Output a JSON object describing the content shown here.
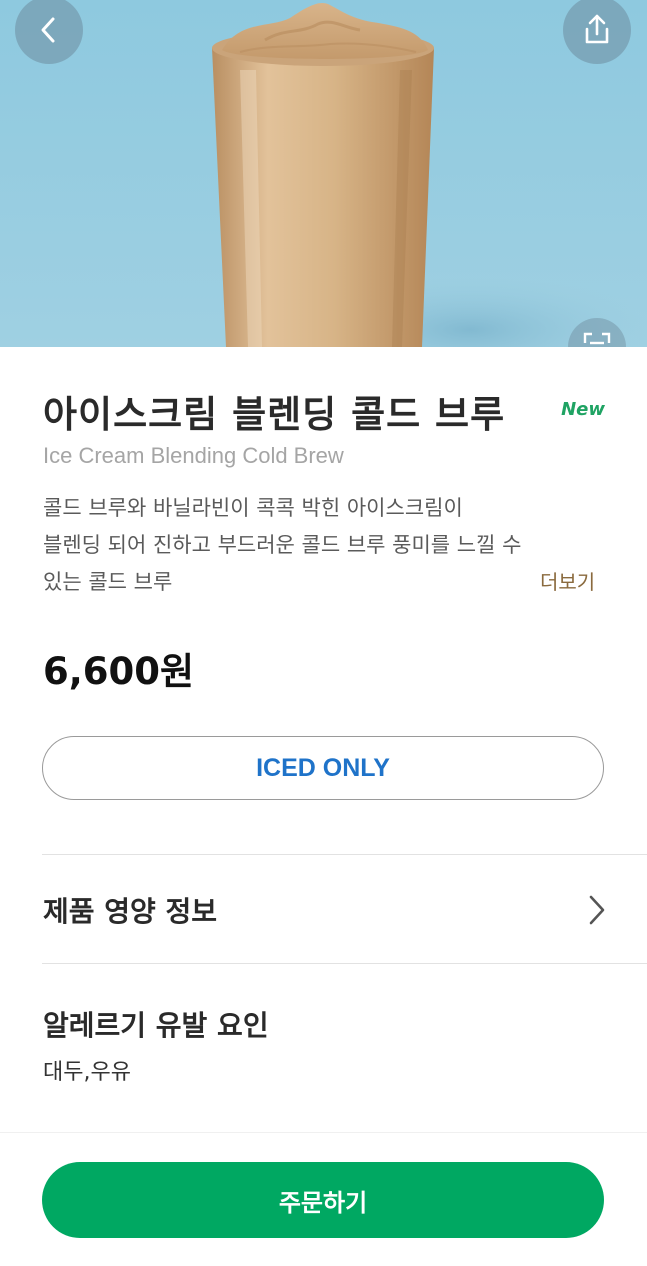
{
  "product": {
    "name_ko": "아이스크림 블렌딩 콜드 브루",
    "badge": "New",
    "name_en": "Ice Cream Blending Cold Brew",
    "description_lines": [
      "콜드 브루와 바닐라빈이 콕콕 박힌 아이스크림이",
      "블렌딩 되어 진하고 부드러운 콜드 브루 풍미를 느낄 수",
      "있는 콜드 브루"
    ],
    "more_label": "더보기",
    "price": "6,600원",
    "temperature_option": "ICED ONLY"
  },
  "sections": {
    "nutrition_title": "제품 영양 정보",
    "allergen_title": "알레르기 유발 요인",
    "allergen_value": "대두,우유"
  },
  "actions": {
    "order_label": "주문하기"
  },
  "icons": {
    "back": "chevron-left-icon",
    "share": "share-icon",
    "zoom": "expand-icon",
    "nutrition_arrow": "chevron-right-icon"
  },
  "colors": {
    "brand_green": "#00a862",
    "new_badge": "#1fa363",
    "iced_only": "#1f73c9",
    "more_link": "#8a6a3e",
    "hero_background": "#8fc7dd"
  }
}
